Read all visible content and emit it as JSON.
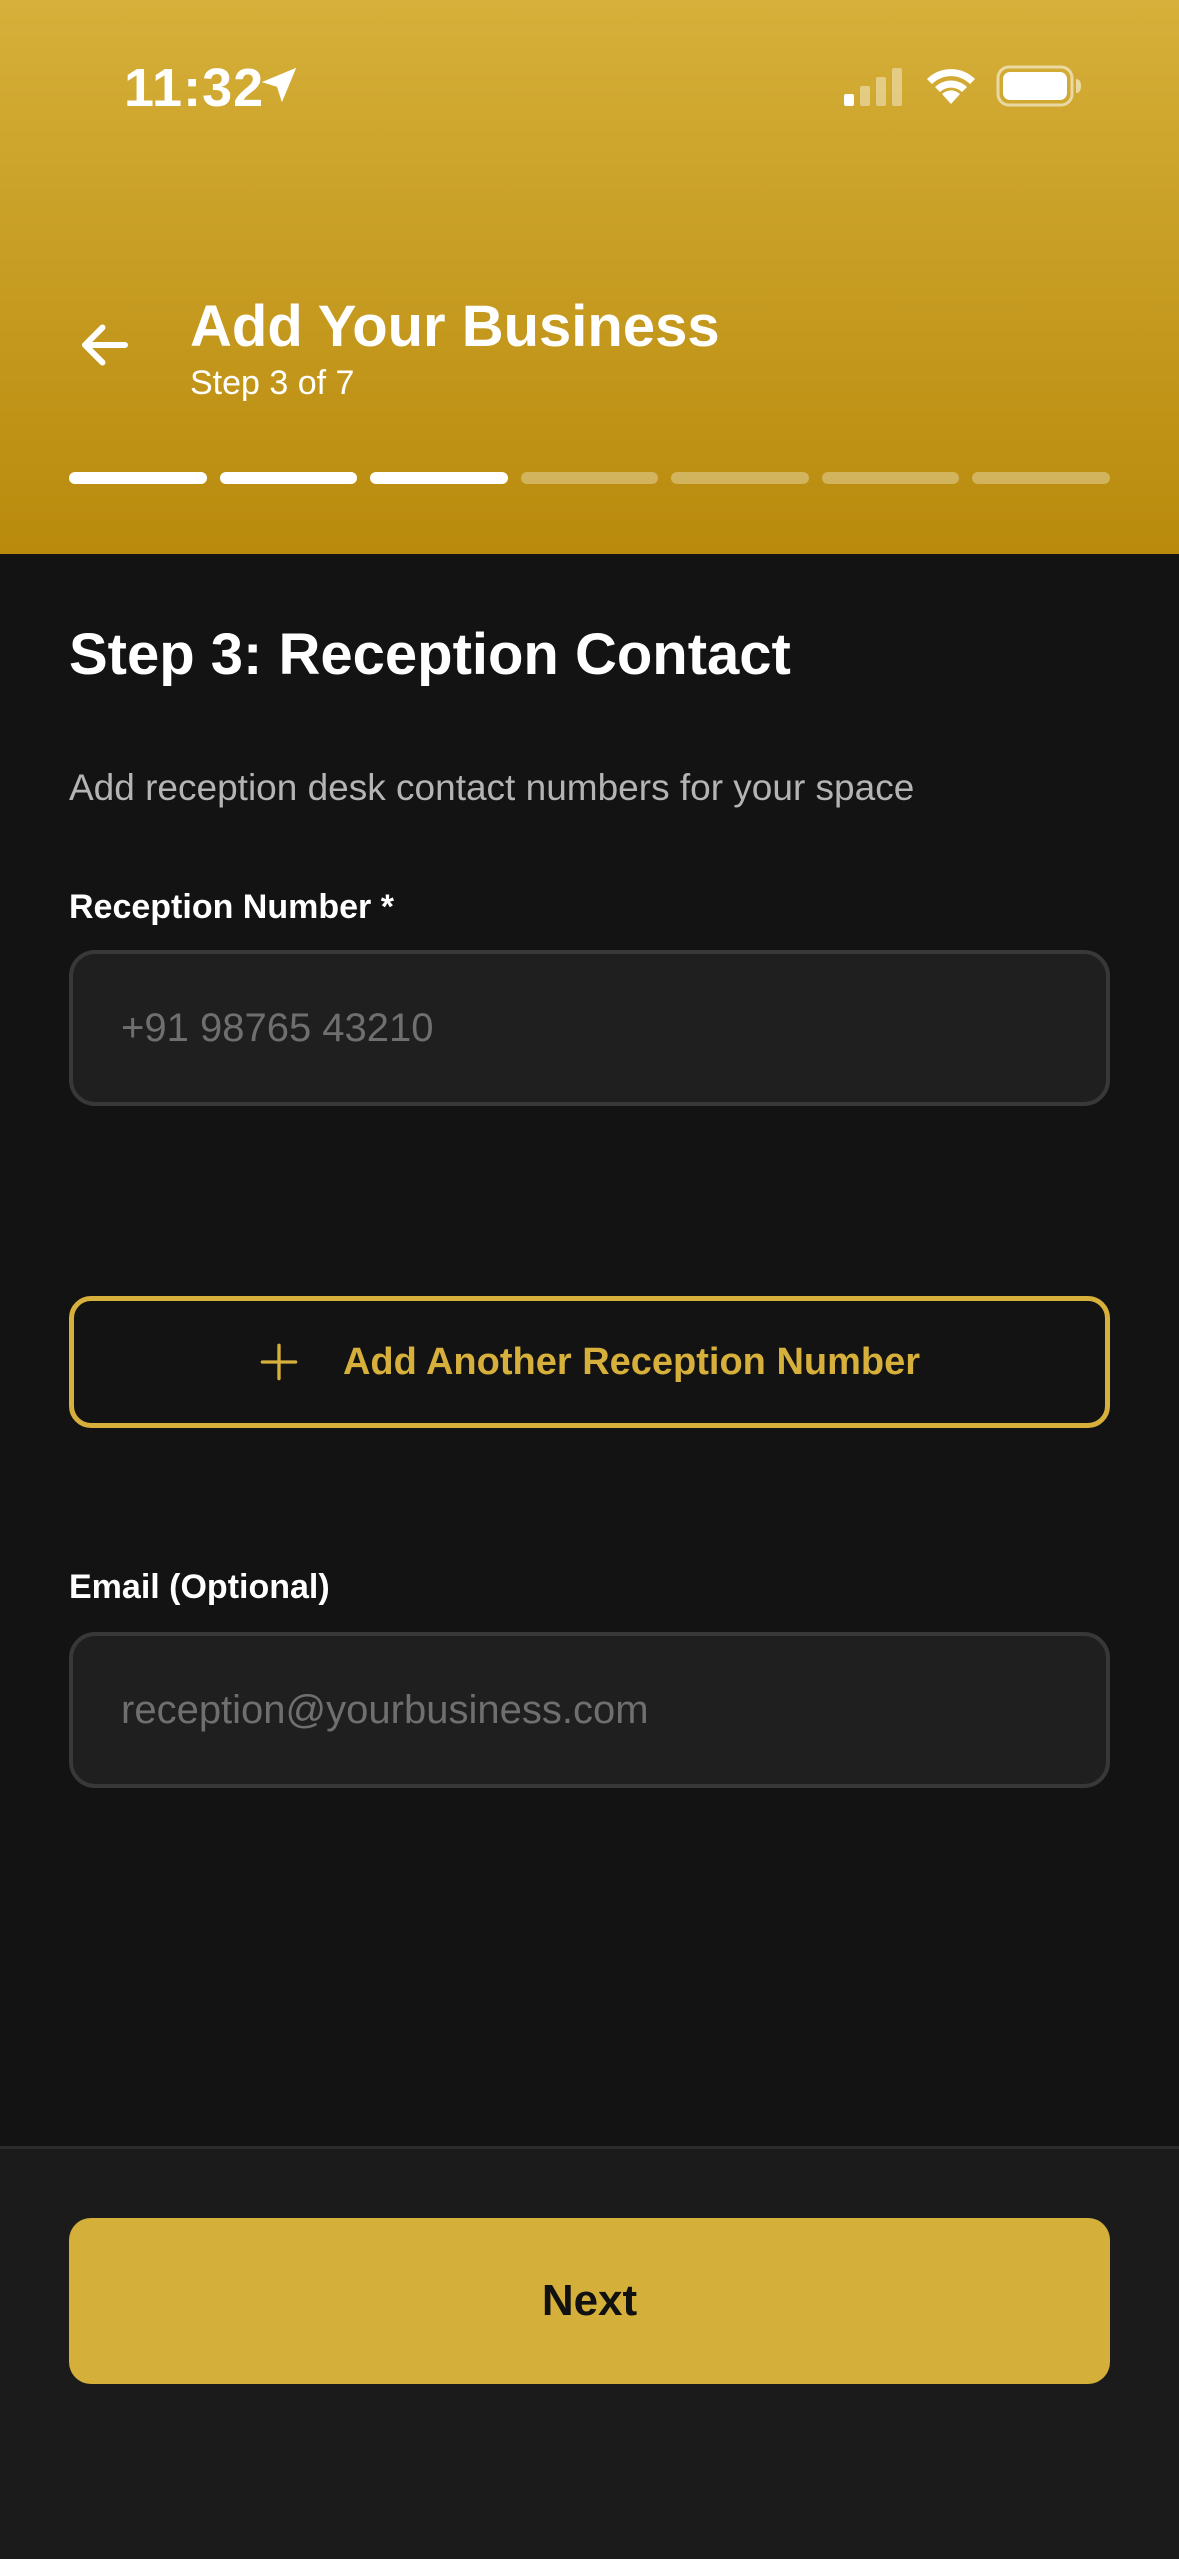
{
  "status_bar": {
    "time": "11:32",
    "icons": [
      "location-arrow-icon",
      "cellular-signal-icon",
      "wifi-icon",
      "battery-icon"
    ]
  },
  "header": {
    "title": "Add Your Business",
    "subtitle": "Step 3 of 7",
    "back_icon": "arrow-left-icon",
    "progress": {
      "current_step": 3,
      "total_steps": 7
    }
  },
  "main": {
    "heading": "Step 3: Reception Contact",
    "description": "Add reception desk contact numbers for your space",
    "reception_number": {
      "label": "Reception Number *",
      "value": "",
      "placeholder": "+91 98765 43210"
    },
    "add_another": {
      "icon": "plus-icon",
      "label": "Add Another Reception Number"
    },
    "email": {
      "label": "Email (Optional)",
      "value": "",
      "placeholder": "reception@yourbusiness.com"
    }
  },
  "footer": {
    "next_label": "Next"
  },
  "colors": {
    "accent": "#d4b03a",
    "header_top": "#d6b03a",
    "header_bottom": "#b98a0c",
    "background": "#131313",
    "input_background": "#1f1f1f",
    "input_border": "#383838",
    "footer_background": "#1b1b1b"
  }
}
